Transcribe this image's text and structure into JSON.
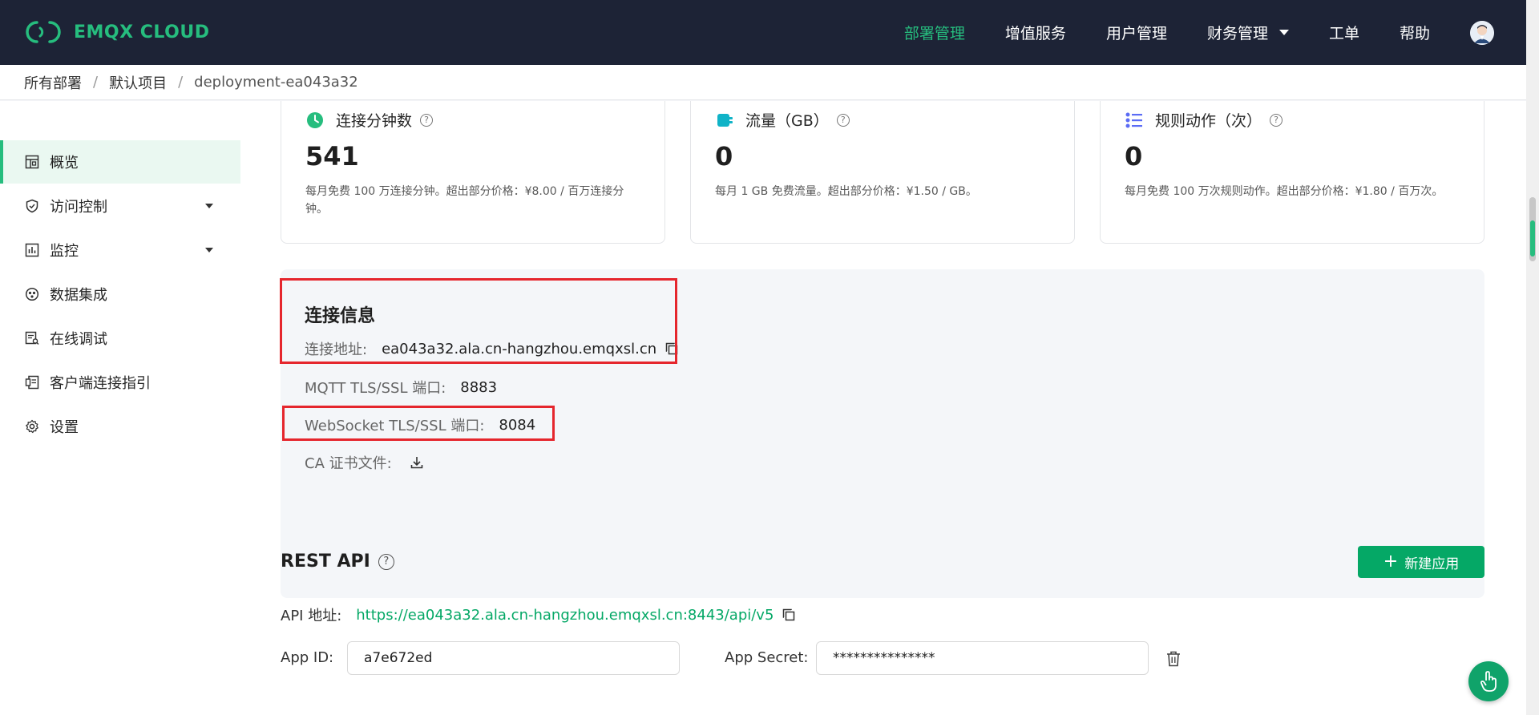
{
  "brand": {
    "name": "EMQX CLOUD",
    "accent": "#26bd7e",
    "nav_bg": "#1d2336"
  },
  "nav": {
    "items": [
      {
        "label": "部署管理",
        "active": true
      },
      {
        "label": "增值服务"
      },
      {
        "label": "用户管理"
      },
      {
        "label": "财务管理",
        "dropdown": true
      },
      {
        "label": "工单"
      },
      {
        "label": "帮助"
      }
    ]
  },
  "breadcrumb": [
    "所有部署",
    "默认项目",
    "deployment-ea043a32"
  ],
  "sidebar": {
    "items": [
      {
        "label": "概览",
        "icon": "dashboard-icon",
        "active": true
      },
      {
        "label": "访问控制",
        "icon": "shield-icon",
        "expandable": true
      },
      {
        "label": "监控",
        "icon": "chart-icon",
        "expandable": true
      },
      {
        "label": "数据集成",
        "icon": "integration-icon"
      },
      {
        "label": "在线调试",
        "icon": "debug-icon"
      },
      {
        "label": "客户端连接指引",
        "icon": "client-guide-icon"
      },
      {
        "label": "设置",
        "icon": "gear-icon"
      }
    ]
  },
  "cards": [
    {
      "title": "连接分钟数",
      "value": "541",
      "desc": "每月免费 100 万连接分钟。超出部分价格：¥8.00 / 百万连接分钟。"
    },
    {
      "title": "流量（GB）",
      "value": "0",
      "desc": "每月 1 GB 免费流量。超出部分价格：¥1.50 / GB。"
    },
    {
      "title": "规则动作（次）",
      "value": "0",
      "desc": "每月免费 100 万次规则动作。超出部分价格：¥1.80 / 百万次。"
    }
  ],
  "connection": {
    "title": "连接信息",
    "address_label": "连接地址:",
    "address": "ea043a32.ala.cn-hangzhou.emqxsl.cn",
    "mqtt_label": "MQTT TLS/SSL 端口:",
    "mqtt_port": "8883",
    "ws_label": "WebSocket TLS/SSL 端口:",
    "ws_port": "8084",
    "ca_label": "CA 证书文件:"
  },
  "rest_api": {
    "title": "REST API",
    "new_app_label": "新建应用",
    "api_label": "API 地址:",
    "api_url": "https://ea043a32.ala.cn-hangzhou.emqxsl.cn:8443/api/v5",
    "app_id_label": "App ID:",
    "app_id": "a7e672ed",
    "app_secret_label": "App Secret:",
    "app_secret": "***************"
  }
}
